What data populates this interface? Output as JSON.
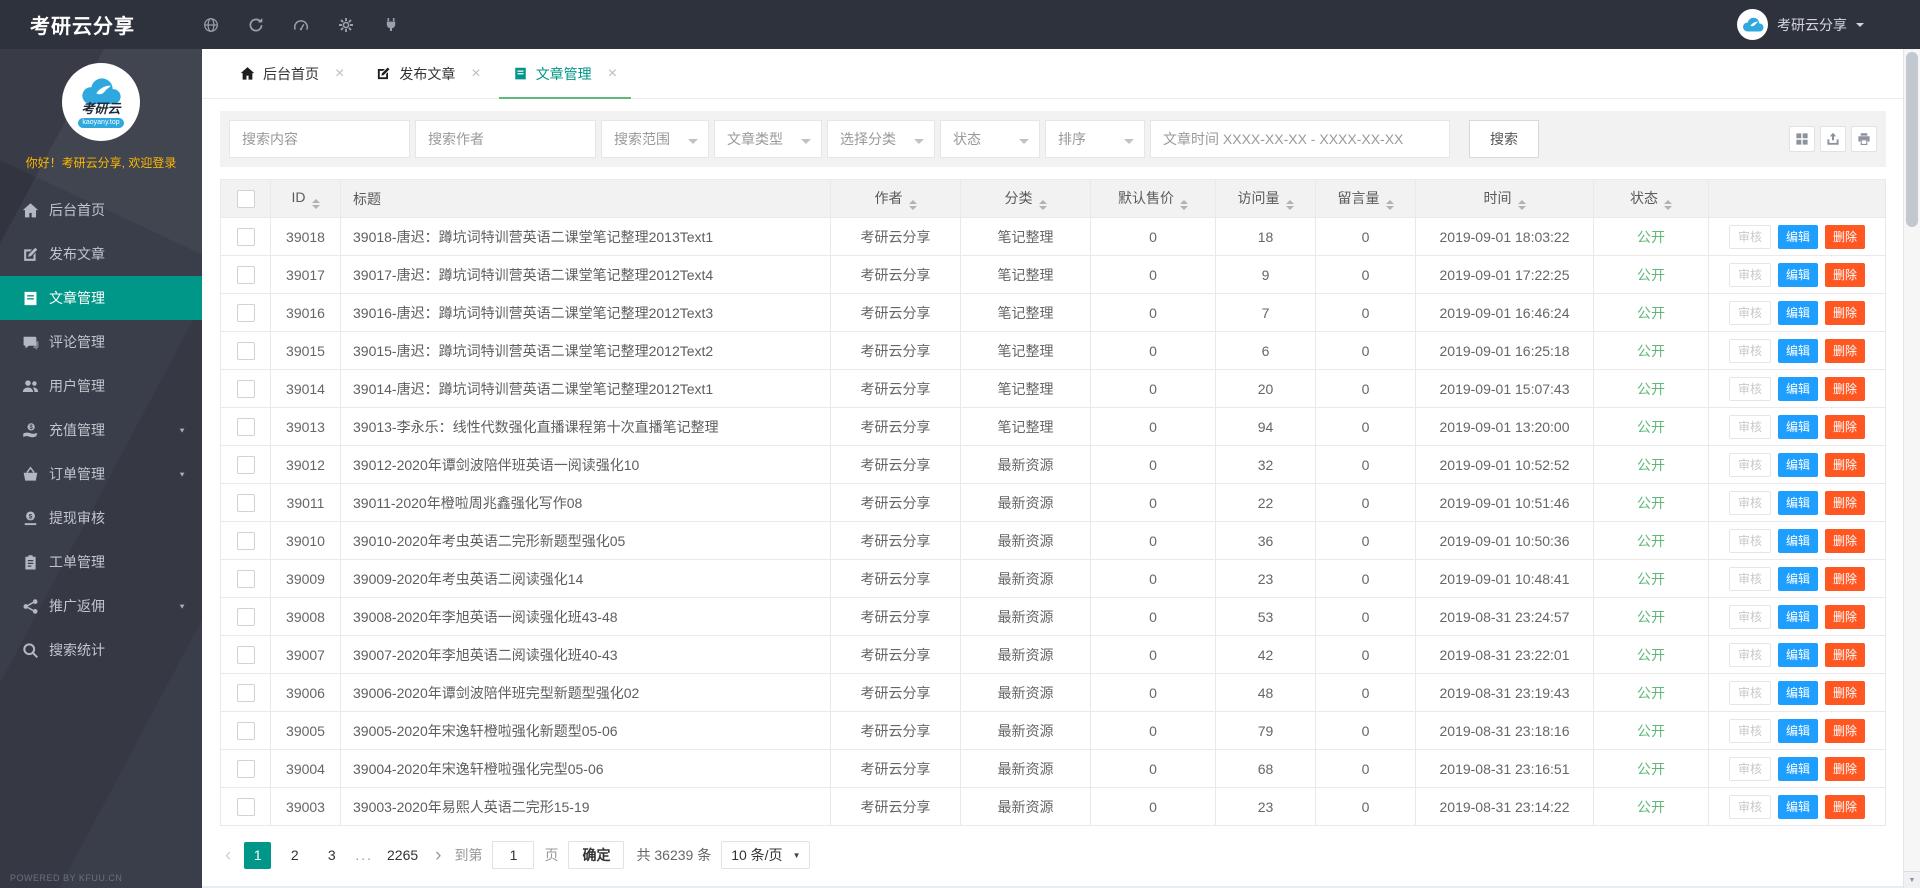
{
  "topbar": {
    "title": "考研云分享",
    "icons": [
      "globe-icon",
      "refresh-icon",
      "gauge-icon",
      "gear-icon",
      "plug-icon"
    ],
    "user": {
      "name": "考研云分享",
      "avatar_icon": "cloud-logo-icon"
    }
  },
  "sidebar": {
    "logo": {
      "line1": "考研云",
      "line2": "kaoyany.top",
      "icon": "cloud-logo-icon"
    },
    "greeting": "你好！考研云分享, 欢迎登录",
    "items": [
      {
        "label": "后台首页",
        "icon": "home-icon",
        "active": false,
        "caret": false
      },
      {
        "label": "发布文章",
        "icon": "edit-icon",
        "active": false,
        "caret": false
      },
      {
        "label": "文章管理",
        "icon": "book-icon",
        "active": true,
        "caret": false
      },
      {
        "label": "评论管理",
        "icon": "comment-icon",
        "active": false,
        "caret": false
      },
      {
        "label": "用户管理",
        "icon": "users-icon",
        "active": false,
        "caret": false
      },
      {
        "label": "充值管理",
        "icon": "recharge-icon",
        "active": false,
        "caret": true
      },
      {
        "label": "订单管理",
        "icon": "orders-icon",
        "active": false,
        "caret": true
      },
      {
        "label": "提现审核",
        "icon": "withdraw-icon",
        "active": false,
        "caret": false
      },
      {
        "label": "工单管理",
        "icon": "work-order-icon",
        "active": false,
        "caret": false
      },
      {
        "label": "推广返佣",
        "icon": "promotion-icon",
        "active": false,
        "caret": true
      },
      {
        "label": "搜索统计",
        "icon": "search-icon",
        "active": false,
        "caret": false
      }
    ],
    "footer": "POWERED BY KFUU.CN"
  },
  "tabs": [
    {
      "label": "后台首页",
      "icon": "home-icon",
      "active": false
    },
    {
      "label": "发布文章",
      "icon": "edit-icon",
      "active": false
    },
    {
      "label": "文章管理",
      "icon": "book-icon",
      "active": true
    }
  ],
  "filters": {
    "search_content_placeholder": "搜索内容",
    "search_author_placeholder": "搜索作者",
    "selects": [
      {
        "label": "搜索范围",
        "name": "scope"
      },
      {
        "label": "文章类型",
        "name": "type"
      },
      {
        "label": "选择分类",
        "name": "category"
      },
      {
        "label": "状态",
        "name": "status"
      },
      {
        "label": "排序",
        "name": "sort"
      }
    ],
    "time_placeholder": "文章时间 XXXX-XX-XX - XXXX-XX-XX",
    "search_button": "搜索",
    "tools": [
      "columns-grid-icon",
      "export-icon",
      "print-icon"
    ]
  },
  "table": {
    "columns": [
      {
        "label": "ID",
        "key": "id",
        "sortable": true
      },
      {
        "label": "标题",
        "key": "title",
        "sortable": false
      },
      {
        "label": "作者",
        "key": "author",
        "sortable": true
      },
      {
        "label": "分类",
        "key": "category",
        "sortable": true
      },
      {
        "label": "默认售价",
        "key": "price",
        "sortable": true
      },
      {
        "label": "访问量",
        "key": "views",
        "sortable": true
      },
      {
        "label": "留言量",
        "key": "comments",
        "sortable": true
      },
      {
        "label": "时间",
        "key": "time",
        "sortable": true
      },
      {
        "label": "状态",
        "key": "status",
        "sortable": true
      }
    ],
    "actions": {
      "audit": "审核",
      "edit": "编辑",
      "delete": "删除"
    },
    "rows": [
      {
        "id": "39018",
        "title": "39018-唐迟：蹲坑词特训营英语二课堂笔记整理2013Text1",
        "author": "考研云分享",
        "category": "笔记整理",
        "price": "0",
        "views": "18",
        "comments": "0",
        "time": "2019-09-01 18:03:22",
        "status": "公开"
      },
      {
        "id": "39017",
        "title": "39017-唐迟：蹲坑词特训营英语二课堂笔记整理2012Text4",
        "author": "考研云分享",
        "category": "笔记整理",
        "price": "0",
        "views": "9",
        "comments": "0",
        "time": "2019-09-01 17:22:25",
        "status": "公开"
      },
      {
        "id": "39016",
        "title": "39016-唐迟：蹲坑词特训营英语二课堂笔记整理2012Text3",
        "author": "考研云分享",
        "category": "笔记整理",
        "price": "0",
        "views": "7",
        "comments": "0",
        "time": "2019-09-01 16:46:24",
        "status": "公开"
      },
      {
        "id": "39015",
        "title": "39015-唐迟：蹲坑词特训营英语二课堂笔记整理2012Text2",
        "author": "考研云分享",
        "category": "笔记整理",
        "price": "0",
        "views": "6",
        "comments": "0",
        "time": "2019-09-01 16:25:18",
        "status": "公开"
      },
      {
        "id": "39014",
        "title": "39014-唐迟：蹲坑词特训营英语二课堂笔记整理2012Text1",
        "author": "考研云分享",
        "category": "笔记整理",
        "price": "0",
        "views": "20",
        "comments": "0",
        "time": "2019-09-01 15:07:43",
        "status": "公开"
      },
      {
        "id": "39013",
        "title": "39013-李永乐：线性代数强化直播课程第十次直播笔记整理",
        "author": "考研云分享",
        "category": "笔记整理",
        "price": "0",
        "views": "94",
        "comments": "0",
        "time": "2019-09-01 13:20:00",
        "status": "公开"
      },
      {
        "id": "39012",
        "title": "39012-2020年谭剑波陪伴班英语一阅读强化10",
        "author": "考研云分享",
        "category": "最新资源",
        "price": "0",
        "views": "32",
        "comments": "0",
        "time": "2019-09-01 10:52:52",
        "status": "公开"
      },
      {
        "id": "39011",
        "title": "39011-2020年橙啦周兆鑫强化写作08",
        "author": "考研云分享",
        "category": "最新资源",
        "price": "0",
        "views": "22",
        "comments": "0",
        "time": "2019-09-01 10:51:46",
        "status": "公开"
      },
      {
        "id": "39010",
        "title": "39010-2020年考虫英语二完形新题型强化05",
        "author": "考研云分享",
        "category": "最新资源",
        "price": "0",
        "views": "36",
        "comments": "0",
        "time": "2019-09-01 10:50:36",
        "status": "公开"
      },
      {
        "id": "39009",
        "title": "39009-2020年考虫英语二阅读强化14",
        "author": "考研云分享",
        "category": "最新资源",
        "price": "0",
        "views": "23",
        "comments": "0",
        "time": "2019-09-01 10:48:41",
        "status": "公开"
      },
      {
        "id": "39008",
        "title": "39008-2020年李旭英语一阅读强化班43-48",
        "author": "考研云分享",
        "category": "最新资源",
        "price": "0",
        "views": "53",
        "comments": "0",
        "time": "2019-08-31 23:24:57",
        "status": "公开"
      },
      {
        "id": "39007",
        "title": "39007-2020年李旭英语二阅读强化班40-43",
        "author": "考研云分享",
        "category": "最新资源",
        "price": "0",
        "views": "42",
        "comments": "0",
        "time": "2019-08-31 23:22:01",
        "status": "公开"
      },
      {
        "id": "39006",
        "title": "39006-2020年谭剑波陪伴班完型新题型强化02",
        "author": "考研云分享",
        "category": "最新资源",
        "price": "0",
        "views": "48",
        "comments": "0",
        "time": "2019-08-31 23:19:43",
        "status": "公开"
      },
      {
        "id": "39005",
        "title": "39005-2020年宋逸轩橙啦强化新题型05-06",
        "author": "考研云分享",
        "category": "最新资源",
        "price": "0",
        "views": "79",
        "comments": "0",
        "time": "2019-08-31 23:18:16",
        "status": "公开"
      },
      {
        "id": "39004",
        "title": "39004-2020年宋逸轩橙啦强化完型05-06",
        "author": "考研云分享",
        "category": "最新资源",
        "price": "0",
        "views": "68",
        "comments": "0",
        "time": "2019-08-31 23:16:51",
        "status": "公开"
      },
      {
        "id": "39003",
        "title": "39003-2020年易熙人英语二完形15-19",
        "author": "考研云分享",
        "category": "最新资源",
        "price": "0",
        "views": "23",
        "comments": "0",
        "time": "2019-08-31 23:14:22",
        "status": "公开"
      }
    ]
  },
  "pagination": {
    "pages": [
      "1",
      "2",
      "3",
      "...",
      "2265"
    ],
    "active": "1",
    "goto_label": "到第",
    "goto_value": "1",
    "page_label": "页",
    "confirm": "确定",
    "total": "共 36239 条",
    "per_page": "10 条/页"
  },
  "colors": {
    "topbar_bg": "#2e323c",
    "sidebar_bg": "#3a3e4a",
    "accent_teal": "#009688",
    "tab_underline_green": "#5fb878",
    "status_green": "#5fb878",
    "edit_blue": "#1e9fff",
    "delete_orange": "#ff5722",
    "greeting_orange": "#ffb800"
  }
}
